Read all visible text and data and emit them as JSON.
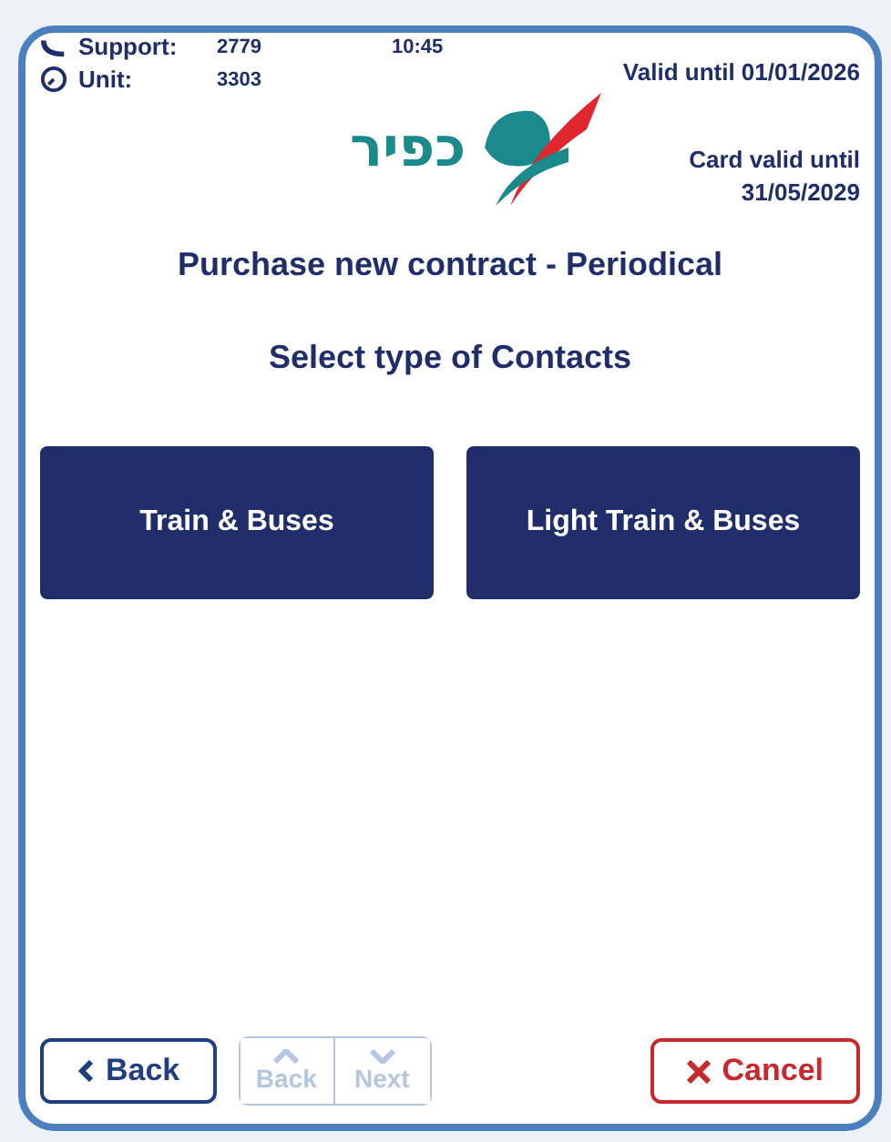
{
  "header": {
    "support_label": "Support:",
    "support_value": "2779",
    "time": "10:45",
    "unit_label": "Unit:",
    "unit_value": "3303",
    "valid_until": "Valid until 01/01/2026",
    "card_valid_label": "Card valid until",
    "card_valid_date": "31/05/2029"
  },
  "logo": {
    "text": "כפיר"
  },
  "title": "Purchase new contract - Periodical",
  "subtitle": "Select type of Contacts",
  "options": [
    {
      "label": "Train & Buses"
    },
    {
      "label": "Light Train & Buses"
    }
  ],
  "footer": {
    "back": "Back",
    "pager": [
      {
        "label": "Back",
        "disabled": true,
        "kind": "up"
      },
      {
        "label": "Next",
        "disabled": true,
        "kind": "down"
      }
    ],
    "cancel": "Cancel"
  }
}
